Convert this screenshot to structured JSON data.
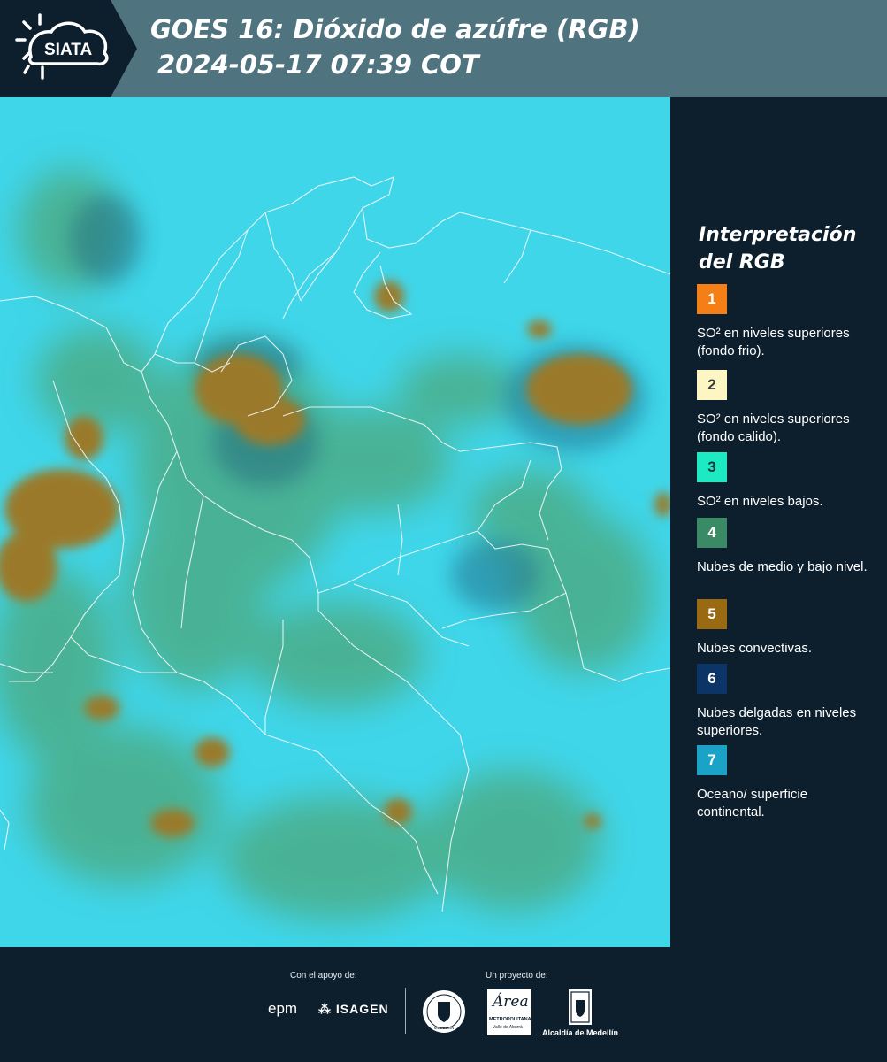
{
  "header": {
    "brand": "SIATA",
    "title_line1": "GOES 16: Dióxido de azúfre (RGB)",
    "title_line2": "2024-05-17 07:39 COT"
  },
  "legend": {
    "title_line1": "Interpretación",
    "title_line2": "del RGB",
    "items": [
      {
        "number": "1",
        "color": "#f57f17",
        "text_color": "#ffffff",
        "label": "SO² en niveles superiores (fondo frio)."
      },
      {
        "number": "2",
        "color": "#fdf6c3",
        "text_color": "#3a3a3a",
        "label": "SO² en niveles superiores (fondo calido)."
      },
      {
        "number": "3",
        "color": "#1de9c3",
        "text_color": "#0d3b3b",
        "label": "SO² en niveles bajos."
      },
      {
        "number": "4",
        "color": "#3a8a66",
        "text_color": "#ffffff",
        "label": "Nubes de medio y bajo nivel."
      },
      {
        "number": "5",
        "color": "#9a6a12",
        "text_color": "#ffffff",
        "label": "Nubes convectivas."
      },
      {
        "number": "6",
        "color": "#0b3566",
        "text_color": "#ffffff",
        "label": "Nubes delgadas en niveles superiores."
      },
      {
        "number": "7",
        "color": "#1ba3c7",
        "text_color": "#ffffff",
        "label": "Oceano/ superficie continental."
      }
    ]
  },
  "footer": {
    "support_label": "Con el apoyo de:",
    "project_label": "Un proyecto de:",
    "sponsor_1": "epm",
    "sponsor_2": "ISAGEN",
    "partner_area": "Área",
    "partner_area_sub": "METROPOLITANA",
    "partner_area_sub2": "Valle de Aburrá",
    "partner_alcaldia": "Alcaldía de Medellín",
    "partner_seal": "MEDELLÍN"
  },
  "map": {
    "background_color": "#3fd6ea"
  }
}
